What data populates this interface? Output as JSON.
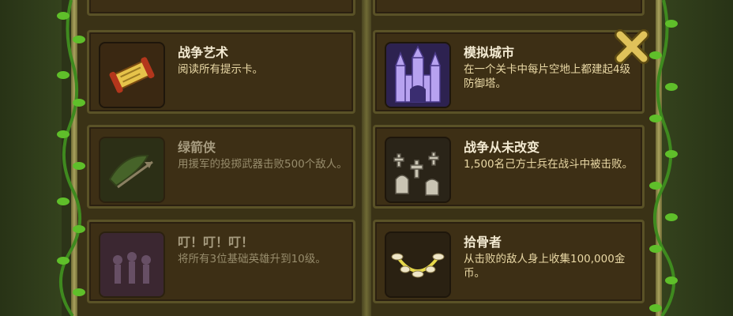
{
  "achievements": [
    {
      "title": "战争艺术",
      "desc": "阅读所有提示卡。",
      "icon": "scroll-icon",
      "locked": false
    },
    {
      "title": "模拟城市",
      "desc": "在一个关卡中每片空地上都建起4级防御塔。",
      "icon": "castle-icon",
      "locked": false
    },
    {
      "title": "绿箭侠",
      "desc": "用援军的投掷武器击败500个敌人。",
      "icon": "arrow-icon",
      "locked": true
    },
    {
      "title": "战争从未改变",
      "desc": "1,500名己方士兵在战斗中被击败。",
      "icon": "graveyard-icon",
      "locked": false
    },
    {
      "title": "叮！叮！叮！",
      "desc": "将所有3位基础英雄升到10级。",
      "icon": "heroes-icon",
      "locked": true
    },
    {
      "title": "拾骨者",
      "desc": "从击败的敌人身上收集100,000金币。",
      "icon": "bone-necklace-icon",
      "locked": false
    }
  ],
  "close_button": {
    "icon": "close-x-icon"
  },
  "colors": {
    "accent": "#e0c25a",
    "card_bg": "#3d2f15",
    "board": "#3a3216"
  }
}
